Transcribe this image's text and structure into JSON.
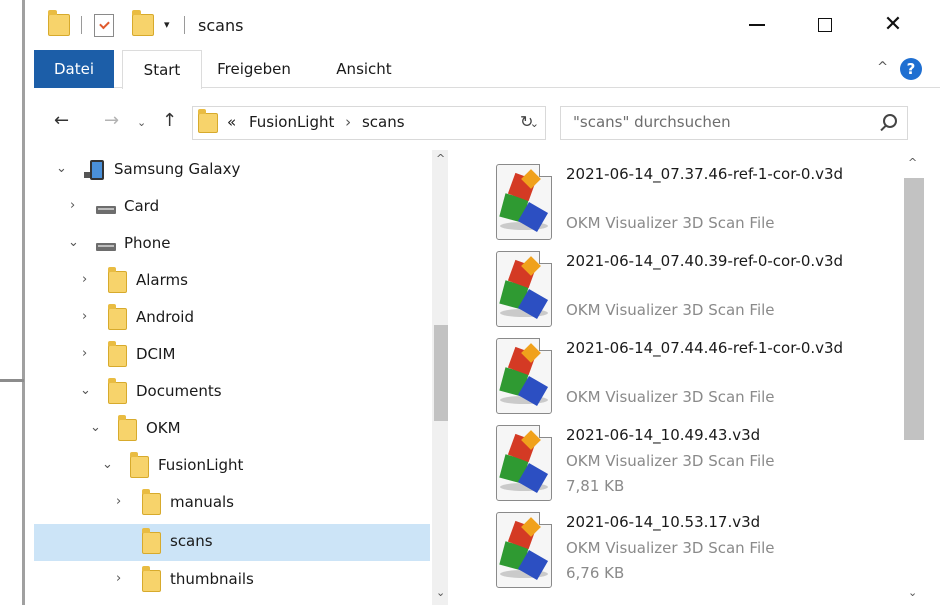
{
  "window": {
    "title": "scans",
    "quick_access_dropdown": "▾",
    "minimize_label": "",
    "close_symbol": "✕"
  },
  "ribbon": {
    "tabs": [
      {
        "label": "Datei",
        "active": false
      },
      {
        "label": "Start",
        "active": true
      },
      {
        "label": "Freigeben",
        "active": false
      },
      {
        "label": "Ansicht",
        "active": false
      }
    ],
    "collapse_symbol": "^",
    "help_symbol": "?"
  },
  "navigation": {
    "back": "←",
    "forward": "→",
    "recent": "⌄",
    "up": "↑",
    "refresh": "↻"
  },
  "address": {
    "overflow": "«",
    "crumbs": [
      "FusionLight",
      "scans"
    ],
    "separator": "›",
    "dropdown": "⌄"
  },
  "search": {
    "placeholder": "\"scans\" durchsuchen"
  },
  "tree": [
    {
      "label": "Samsung Galaxy",
      "icon": "phone-icon",
      "expanded": true
    },
    {
      "label": "Card",
      "icon": "drive-icon",
      "expanded": false
    },
    {
      "label": "Phone",
      "icon": "drive-icon",
      "expanded": true
    },
    {
      "label": "Alarms",
      "icon": "folder-icon",
      "expanded": false
    },
    {
      "label": "Android",
      "icon": "folder-icon",
      "expanded": false
    },
    {
      "label": "DCIM",
      "icon": "folder-icon",
      "expanded": false
    },
    {
      "label": "Documents",
      "icon": "folder-icon",
      "expanded": true
    },
    {
      "label": "OKM",
      "icon": "folder-icon",
      "expanded": true
    },
    {
      "label": "FusionLight",
      "icon": "folder-icon",
      "expanded": true
    },
    {
      "label": "manuals",
      "icon": "folder-icon",
      "expanded": false
    },
    {
      "label": "scans",
      "icon": "folder-icon",
      "selected": true
    },
    {
      "label": "thumbnails",
      "icon": "folder-icon",
      "expanded": false
    }
  ],
  "chevrons": {
    "collapsed": "›",
    "expanded": "⌄",
    "scroll_up": "^",
    "scroll_down": "⌄"
  },
  "files": [
    {
      "name": "2021-06-14_07.37.46-ref-1-cor-0.v3d",
      "type": "OKM Visualizer 3D Scan File",
      "size": ""
    },
    {
      "name": "2021-06-14_07.40.39-ref-0-cor-0.v3d",
      "type": "OKM Visualizer 3D Scan File",
      "size": ""
    },
    {
      "name": "2021-06-14_07.44.46-ref-1-cor-0.v3d",
      "type": "OKM Visualizer 3D Scan File",
      "size": ""
    },
    {
      "name": "2021-06-14_10.49.43.v3d",
      "type": "OKM Visualizer 3D Scan File",
      "size": "7,81 KB"
    },
    {
      "name": "2021-06-14_10.53.17.v3d",
      "type": "OKM Visualizer 3D Scan File",
      "size": "6,76 KB"
    }
  ],
  "colors": {
    "accent": "#1c5ea8",
    "selection": "#cce4f7",
    "folder": "#f7d36b",
    "secondary_text": "#8a8a8a"
  }
}
